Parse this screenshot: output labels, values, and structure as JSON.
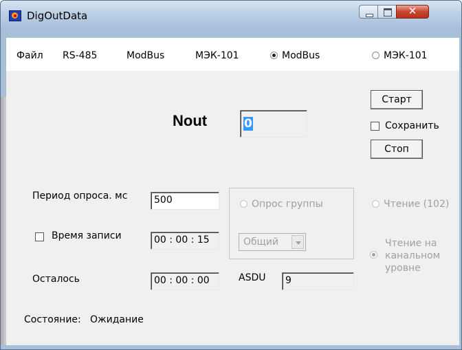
{
  "window": {
    "title": "DigOutData"
  },
  "menu": {
    "file": "Файл",
    "rs485": "RS-485",
    "modbus": "ModBus",
    "mek101": "МЭК-101",
    "radio_modbus": "ModBus",
    "radio_mek101": "МЭК-101",
    "selected": "ModBus"
  },
  "main": {
    "nout_label": "Nout",
    "nout_value": "0",
    "start_button": "Старт",
    "save_checkbox": "Сохранить",
    "stop_button": "Стоп",
    "period_label": "Период опроса. мс",
    "period_value": "500",
    "write_time_label": "Время записи",
    "write_time_value": "00 : 00 : 15",
    "remaining_label": "Осталось",
    "remaining_value": "00 : 00 : 00",
    "group_poll_label": "Опрос группы",
    "group_combo_value": "Общий",
    "asdu_label": "ASDU",
    "asdu_value": "9",
    "read_102_label": "Чтение (102)",
    "read_link_level_label_line1": "Чтение на",
    "read_link_level_label_line2": "канальном",
    "read_link_level_label_line3": "уровне",
    "status_label": "Состояние:",
    "status_value": "Ожидание"
  }
}
